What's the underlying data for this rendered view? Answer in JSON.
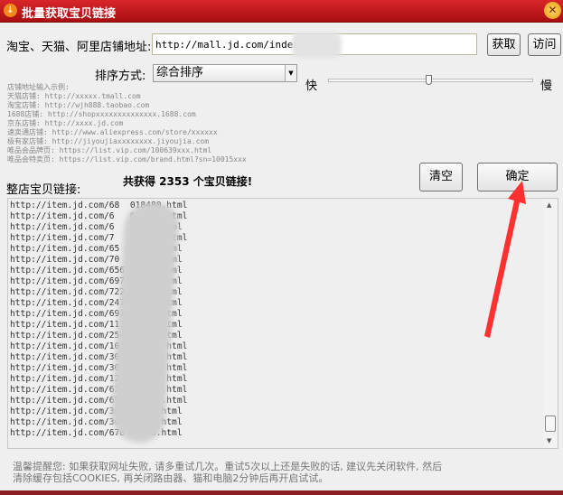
{
  "window": {
    "title": "批量获取宝贝链接",
    "close": "✕"
  },
  "form": {
    "address_label": "淘宝、天猫、阿里店铺地址:",
    "address_value": "http://mall.jd.com/index-",
    "fetch_button": "获取",
    "visit_button": "访问",
    "sort_label": "排序方式:",
    "sort_value": "综合排序",
    "speed_fast": "快",
    "speed_slow": "慢",
    "speed_value_percent": 49
  },
  "examples": [
    "店铺地址输入示例:",
    "天猫店铺: http://xxxxx.tmall.com",
    "淘宝店铺: http://wjh888.taobao.com",
    "1688店铺: http://shopxxxxxxxxxxxxxx.1688.com",
    "京东店铺: http://xxxx.jd.com",
    "速卖通店铺: http://www.aliexpress.com/store/xxxxxx",
    "极有家店铺: http://jiyoujiaxxxxxxxx.jiyoujia.com",
    "唯品会品牌页: https://list.vip.com/100639xxx.html",
    "唯品会特卖页: https://list.vip.com/brand.html?sn=10015xxx"
  ],
  "results": {
    "label": "整店宝贝链接:",
    "count_text": "共获得 2353 个宝贝链接!",
    "clear_button": "清空",
    "confirm_button": "确定",
    "links": [
      "http://item.jd.com/68  018480.html",
      "http://item.jd.com/6   023373.html",
      "http://item.jd.com/6   32813.html",
      "http://item.jd.com/7    52867.html",
      "http://item.jd.com/65   6707.html",
      "http://item.jd.com/70    524.html",
      "http://item.jd.com/656   460.html",
      "http://item.jd.com/697   582.html",
      "http://item.jd.com/7222   34.html",
      "http://item.jd.com/2474   27.html",
      "http://item.jd.com/69116   4.html",
      "http://item.jd.com/11161    .html",
      "http://item.jd.com/25469    .html",
      "http://item.jd.com/103802    .html",
      "http://item.jd.com/304158    .html",
      "http://item.jd.com/3023180   .html",
      "http://item.jd.com/1271273   .html",
      "http://item.jd.com/626119    .html",
      "http://item.jd.com/658262    .html",
      "http://item.jd.com/3041     .html",
      "http://item.jd.com/3041   10.html",
      "http://item.jd.com/678   036.html"
    ]
  },
  "notice": "温馨提醒您: 如果获取网址失败, 请多重试几次。重试5次以上还是失败的话, 建议先关闭软件, 然后\n清除缓存包括COOKIES, 再关闭路由器、猫和电脑2分钟后再开启试试。"
}
